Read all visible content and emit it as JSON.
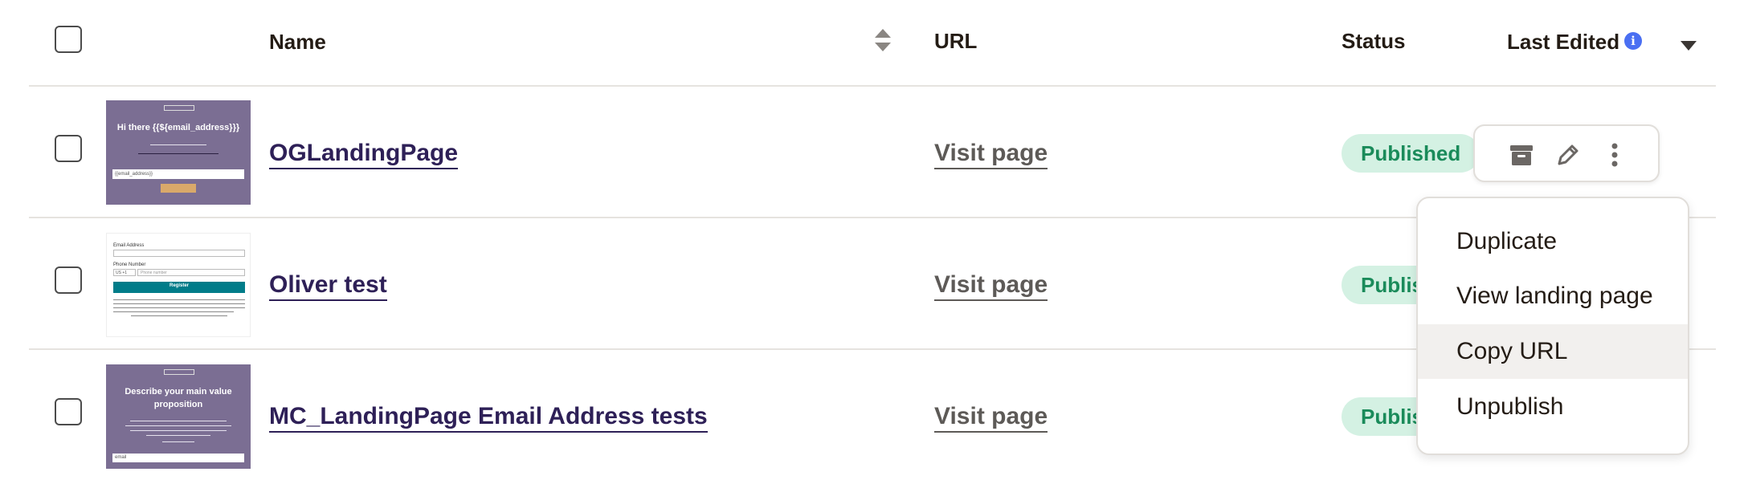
{
  "header": {
    "name": "Name",
    "url": "URL",
    "status": "Status",
    "last_edited": "Last Edited",
    "info_glyph": "i"
  },
  "rows": [
    {
      "name": "OGLandingPage",
      "url_link": "Visit page",
      "status": "Published",
      "thumbnail": {
        "style": "purple",
        "heading": "Hi there {{${email_address}}}",
        "input_text": "{{email_address}}"
      }
    },
    {
      "name": "Oliver test",
      "url_link": "Visit page",
      "status": "Published",
      "thumbnail": {
        "style": "white",
        "label_email": "Email Address",
        "label_phone": "Phone Number",
        "country_code": "US +1",
        "phone_placeholder": "Phone number",
        "button": "Register"
      }
    },
    {
      "name": "MC_LandingPage Email Address tests",
      "url_link": "Visit page",
      "status": "Published",
      "thumbnail": {
        "style": "purple",
        "heading": "Describe your main value proposition",
        "input_text": "email"
      }
    }
  ],
  "action_bar": {
    "icons": [
      "archive-icon",
      "pencil-icon",
      "more-vertical-icon"
    ]
  },
  "menu": {
    "items": [
      "Duplicate",
      "View landing page",
      "Copy URL",
      "Unpublish"
    ],
    "highlighted_index": 2
  },
  "colors": {
    "link": "#2e2057",
    "badge_bg": "#d4f1e3",
    "badge_text": "#1a8b5a",
    "info": "#4a6ff2",
    "thumb_purple": "#7b6e93"
  }
}
